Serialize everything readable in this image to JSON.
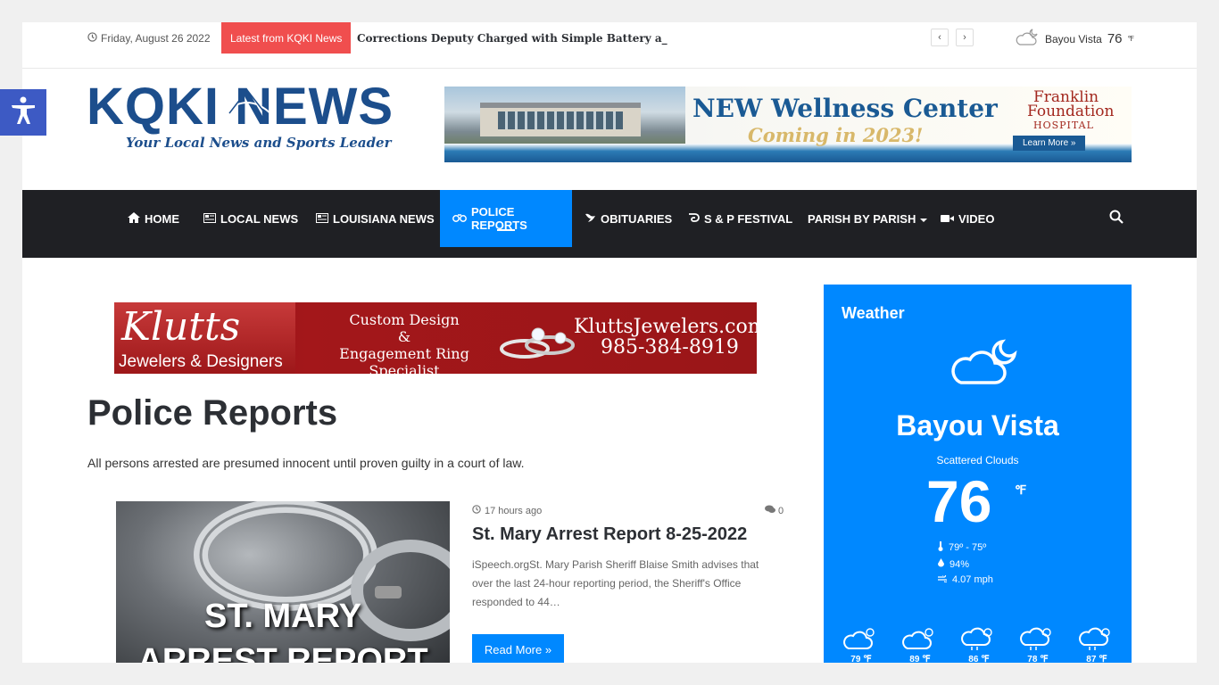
{
  "topbar": {
    "date": "Friday, August 26 2022",
    "latest_badge": "Latest from KQKI News",
    "ticker": "Corrections Deputy Charged with Simple Battery a_",
    "weather_city": "Bayou Vista",
    "weather_temp": "76",
    "weather_unit": "℉"
  },
  "header": {
    "logo_text": "KQKI NEWS",
    "logo_tagline": "Your Local News and Sports Leader",
    "ad": {
      "title": "NEW Wellness Center",
      "subtitle": "Coming in 2023!",
      "brand_l1": "Franklin",
      "brand_l2": "Foundation",
      "brand_l3": "HOSPITAL",
      "cta": "Learn More »"
    }
  },
  "nav": {
    "items": [
      {
        "label": "HOME",
        "icon": "home-icon"
      },
      {
        "label": "LOCAL NEWS",
        "icon": "newspaper-icon"
      },
      {
        "label": "LOUISIANA NEWS",
        "icon": "newspaper-icon"
      },
      {
        "label": "POLICE REPORTS",
        "icon": "handcuffs-icon"
      },
      {
        "label": "OBITUARIES",
        "icon": "dove-icon"
      },
      {
        "label": "S & P FESTIVAL",
        "icon": "shrimp-icon"
      },
      {
        "label": "PARISH BY PARISH",
        "icon": "caret-down-icon"
      },
      {
        "label": "VIDEO",
        "icon": "video-icon"
      }
    ],
    "active_index": 3,
    "accent": "#0088ff"
  },
  "content_ad": {
    "script": "Klutts",
    "sub": "Jewelers & Designers",
    "mid_l1": "Custom Design",
    "mid_l2": "&",
    "mid_l3": "Engagement Ring Specialist",
    "url": "KluttsJewelers.com",
    "phone": "985-384-8919"
  },
  "main": {
    "page_title": "Police Reports",
    "description": "All persons arrested are presumed innocent until proven guilty in a court of law.",
    "post": {
      "thumb_l1": "ST. MARY",
      "thumb_l2": "ARREST REPORT",
      "time": "17 hours ago",
      "comments": "0",
      "title": "St. Mary Arrest Report 8-25-2022",
      "excerpt": "iSpeech.orgSt. Mary Parish Sheriff Blaise Smith advises that over the last 24-hour reporting period, the Sheriff's Office responded to 44…",
      "read_more": "Read More »"
    }
  },
  "weather": {
    "title": "Weather",
    "city": "Bayou Vista",
    "condition": "Scattered Clouds",
    "temp": "76",
    "unit": "℉",
    "range": "79º - 75º",
    "humidity": "94%",
    "wind": "4.07 mph",
    "forecast": [
      {
        "temp": "79 ℉",
        "icon": "cloud-sun-icon"
      },
      {
        "temp": "89 ℉",
        "icon": "cloud-sun-icon"
      },
      {
        "temp": "86 ℉",
        "icon": "rain-sun-icon"
      },
      {
        "temp": "78 ℉",
        "icon": "rain-sun-icon"
      },
      {
        "temp": "87 ℉",
        "icon": "rain-sun-icon"
      }
    ]
  }
}
